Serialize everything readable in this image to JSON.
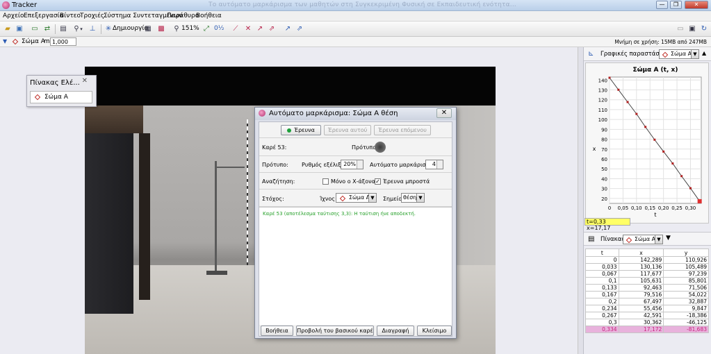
{
  "window": {
    "title": "Tracker",
    "blurred_title": "Το αυτόματο μαρκάρισμα των μαθητών στη Συγκεκριμένη Φυσική σε Εκπαιδευτική ενότητα...",
    "min": "—",
    "max": "❐",
    "close": "✕"
  },
  "menu": [
    "Αρχείο",
    "Επεξεργασία",
    "Βίντεο",
    "Τροχιές",
    "Σύστημα Συντεταγμένων",
    "Παράθυρο",
    "Βοήθεια"
  ],
  "toolbar": {
    "create_label": "Δημιουργία",
    "zoom_label": "151%",
    "angle_label": "0½"
  },
  "trackbar": {
    "track_name": "Σώμα Α",
    "mass_label": "m",
    "mass_value": "1,000",
    "memory": "Μνήμη σε χρήση: 15MB από 247MB"
  },
  "track_panel": {
    "title": "Πίνακας Ελέ...",
    "item": "Σώμα Α"
  },
  "dialog": {
    "title": "Αυτόματο μαρκάρισμα: Σώμα Α θέση",
    "search_btn": "Έρευνα",
    "search_this_btn": "Έρευνα αυτού",
    "search_next_btn": "Έρευνα επόμενου",
    "frame_label": "Καρέ 53:",
    "template_label": "Πρότυπο",
    "template_row_label": "Πρότυπο:",
    "evolution_label": "Ρυθμός εξέλιξης",
    "evolution_value": "20%",
    "auto_mark_label": "Αυτόματο μαρκάρισμα",
    "auto_mark_value": "4",
    "search_row_label": "Αναζήτηση:",
    "x_axis_only": "Μόνο ο Χ-άξονας",
    "look_ahead": "Έρευνα μπροστά",
    "look_ahead_checked": "✓",
    "target_label": "Στόχος:",
    "track_label": "Ίχνος",
    "track_value": "Σώμα Α",
    "point_label": "Σημείο",
    "point_value": "θέση",
    "message": "Καρέ 53 (αποτέλεσμα ταύτισης 3,3): Η ταύτιση ήνε αποδεκτή.",
    "help_btn": "Βοήθεια",
    "show_keyframe_btn": "Προβολή του βασικού καρέ",
    "delete_btn": "Διαγραφή",
    "close_btn": "Κλείσιμο"
  },
  "graph_header": {
    "label": "Γραφικές παραστάσεις",
    "track": "Σώμα Α"
  },
  "table_header": {
    "label": "Πίνακας",
    "track": "Σώμα Α"
  },
  "readout": "t=0,33  x=17,17",
  "chart_data": {
    "type": "line",
    "title": "Σώμα Α (t, x)",
    "xlabel": "t",
    "ylabel": "x",
    "xlim": [
      0,
      0.34
    ],
    "ylim": [
      15,
      143
    ],
    "xticks": [
      "0",
      "0,05",
      "0,10",
      "0,15",
      "0,20",
      "0,25",
      "0,30"
    ],
    "yticks": [
      "20",
      "30",
      "40",
      "50",
      "60",
      "70",
      "80",
      "90",
      "100",
      "110",
      "120",
      "130",
      "140"
    ],
    "x": [
      0,
      0.033,
      0.067,
      0.1,
      0.133,
      0.167,
      0.2,
      0.234,
      0.267,
      0.3,
      0.334
    ],
    "values": [
      142.289,
      130.136,
      117.677,
      105.631,
      92.463,
      79.516,
      67.497,
      55.456,
      42.591,
      30.362,
      17.172
    ],
    "grid": true
  },
  "table": {
    "columns": [
      "t",
      "x",
      "y"
    ],
    "rows": [
      [
        "0",
        "142,289",
        "110,926"
      ],
      [
        "0,033",
        "130,136",
        "105,489"
      ],
      [
        "0,067",
        "117,677",
        "97,239"
      ],
      [
        "0,1",
        "105,631",
        "85,801"
      ],
      [
        "0,133",
        "92,463",
        "71,506"
      ],
      [
        "0,167",
        "79,516",
        "54,022"
      ],
      [
        "0,2",
        "67,497",
        "32,887"
      ],
      [
        "0,234",
        "55,456",
        "9,847"
      ],
      [
        "0,267",
        "42,591",
        "-18,386"
      ],
      [
        "0,3",
        "30,362",
        "-46,125"
      ],
      [
        "0,334",
        "17,172",
        "-81,683"
      ]
    ]
  },
  "colors": {
    "accent": "#c0302a",
    "message": "#26a02a",
    "selected_row": "#e8b2dc",
    "readout_bg": "#ffff66"
  }
}
